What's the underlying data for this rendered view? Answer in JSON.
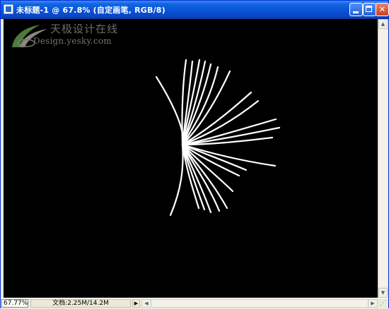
{
  "window": {
    "title": "未标题-1 @ 67.8% (自定画笔, RGB/8)"
  },
  "window_controls": {
    "minimize_label": "",
    "maximize_label": "",
    "close_label": "✕"
  },
  "canvas": {
    "background": "#000000",
    "stroke_color": "#ffffff"
  },
  "watermark": {
    "cn_text": "天极设计在线",
    "en_text": "Design.yesky.com"
  },
  "status": {
    "zoom": "67.77%",
    "doc_info": "文档:2.25M/14.2M",
    "menu_arrow": "▶"
  },
  "scrollbars": {
    "up_arrow": "▲",
    "down_arrow": "▼",
    "left_arrow": "◀",
    "right_arrow": "▶"
  }
}
